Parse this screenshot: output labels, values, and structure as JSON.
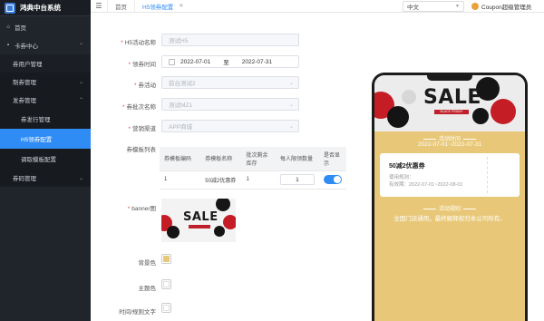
{
  "app": {
    "title": "鸿典中台系统"
  },
  "sidebar": {
    "items": [
      {
        "label": "首页",
        "icon": "home-icon"
      },
      {
        "label": "卡券中心",
        "icon": "card-icon"
      },
      {
        "label": "券用户管理"
      },
      {
        "label": "制券管理"
      },
      {
        "label": "发券管理"
      },
      {
        "label": "券发行管理"
      },
      {
        "label": "H5领券配置"
      },
      {
        "label": "调取模板配置"
      },
      {
        "label": "券码管理"
      }
    ]
  },
  "topbar": {
    "menu_icon": "hamburger-icon",
    "tabs": [
      {
        "label": "首页"
      },
      {
        "label": "H5领券配置"
      }
    ],
    "language": "中文",
    "user": "Coupon超级管理员"
  },
  "form": {
    "name_label": "H5活动名称",
    "name_placeholder": "测试H5",
    "time_label": "领券时间",
    "start_date": "2022-07-01",
    "range_sep": "至",
    "end_date": "2022-07-31",
    "activity_label": "券活动",
    "activity_value": "前台测试2",
    "batch_label": "券批次名称",
    "batch_value": "测试MZ1",
    "channel_label": "营销渠道",
    "channel_value": "APP商城",
    "template_label": "券模板列表",
    "banner_label": "banner图",
    "bg_color_label": "背景色",
    "theme_color_label": "主题色",
    "period_text_label": "时间/规则文字"
  },
  "table": {
    "headers": [
      "券模板编码",
      "券模板名称",
      "批次剩余库存",
      "每人限领数量",
      "是否显示"
    ],
    "rows": [
      {
        "code": "1",
        "name": "50减2优惠券",
        "stock": "1",
        "limit": "1",
        "show": true
      }
    ]
  },
  "colors": {
    "accent": "#2f8cf5",
    "background_color": "#e8c878",
    "theme_color": "#ffffff"
  },
  "banner": {
    "title": "SALE",
    "subtitle": "BLACK FRIDAY"
  },
  "preview": {
    "period_title": "活动时间",
    "period": "2022-07-01~2022-07-31",
    "coupon_title": "50减2优惠券",
    "coupon_usage": "使用规则：",
    "coupon_valid": "有效期：2022-07-01~2022-08-01",
    "rules_title": "活动规则",
    "rules_text": "全国门店通用，最终解释权归本公司所有。"
  }
}
